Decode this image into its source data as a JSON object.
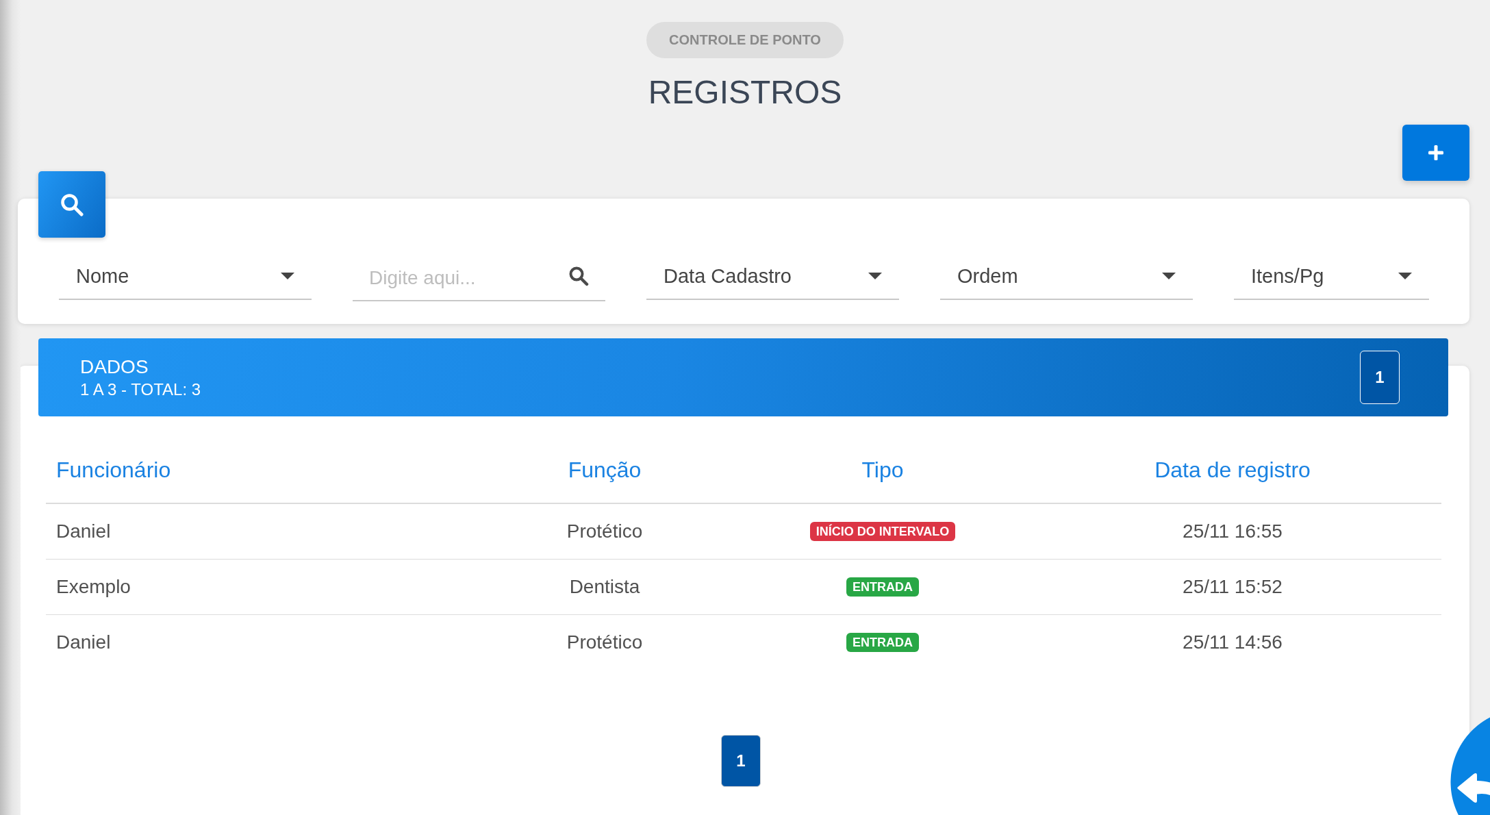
{
  "header": {
    "tag": "CONTROLE DE PONTO",
    "title": "REGISTROS"
  },
  "filters": [
    {
      "kind": "select",
      "label": "Nome"
    },
    {
      "kind": "search",
      "placeholder": "Digite aqui..."
    },
    {
      "kind": "select",
      "label": "Data Cadastro"
    },
    {
      "kind": "select",
      "label": "Ordem"
    },
    {
      "kind": "select",
      "label": "Itens/Pg"
    }
  ],
  "data_panel": {
    "title": "DADOS",
    "range": "1 A 3 - TOTAL: 3",
    "page_badge": "1"
  },
  "table": {
    "columns": [
      "Funcionário",
      "Função",
      "Tipo",
      "Data de registro"
    ],
    "rows": [
      {
        "funcionario": "Daniel",
        "funcao": "Protético",
        "tipo": {
          "label": "INÍCIO DO INTERVALO",
          "color": "#dc3545"
        },
        "data_registro": "25/11 16:55"
      },
      {
        "funcionario": "Exemplo",
        "funcao": "Dentista",
        "tipo": {
          "label": "ENTRADA",
          "color": "#28a745"
        },
        "data_registro": "25/11 15:52"
      },
      {
        "funcionario": "Daniel",
        "funcao": "Protético",
        "tipo": {
          "label": "ENTRADA",
          "color": "#28a745"
        },
        "data_registro": "25/11 14:56"
      }
    ]
  },
  "pagination": [
    {
      "label": "1",
      "selected": true
    }
  ]
}
